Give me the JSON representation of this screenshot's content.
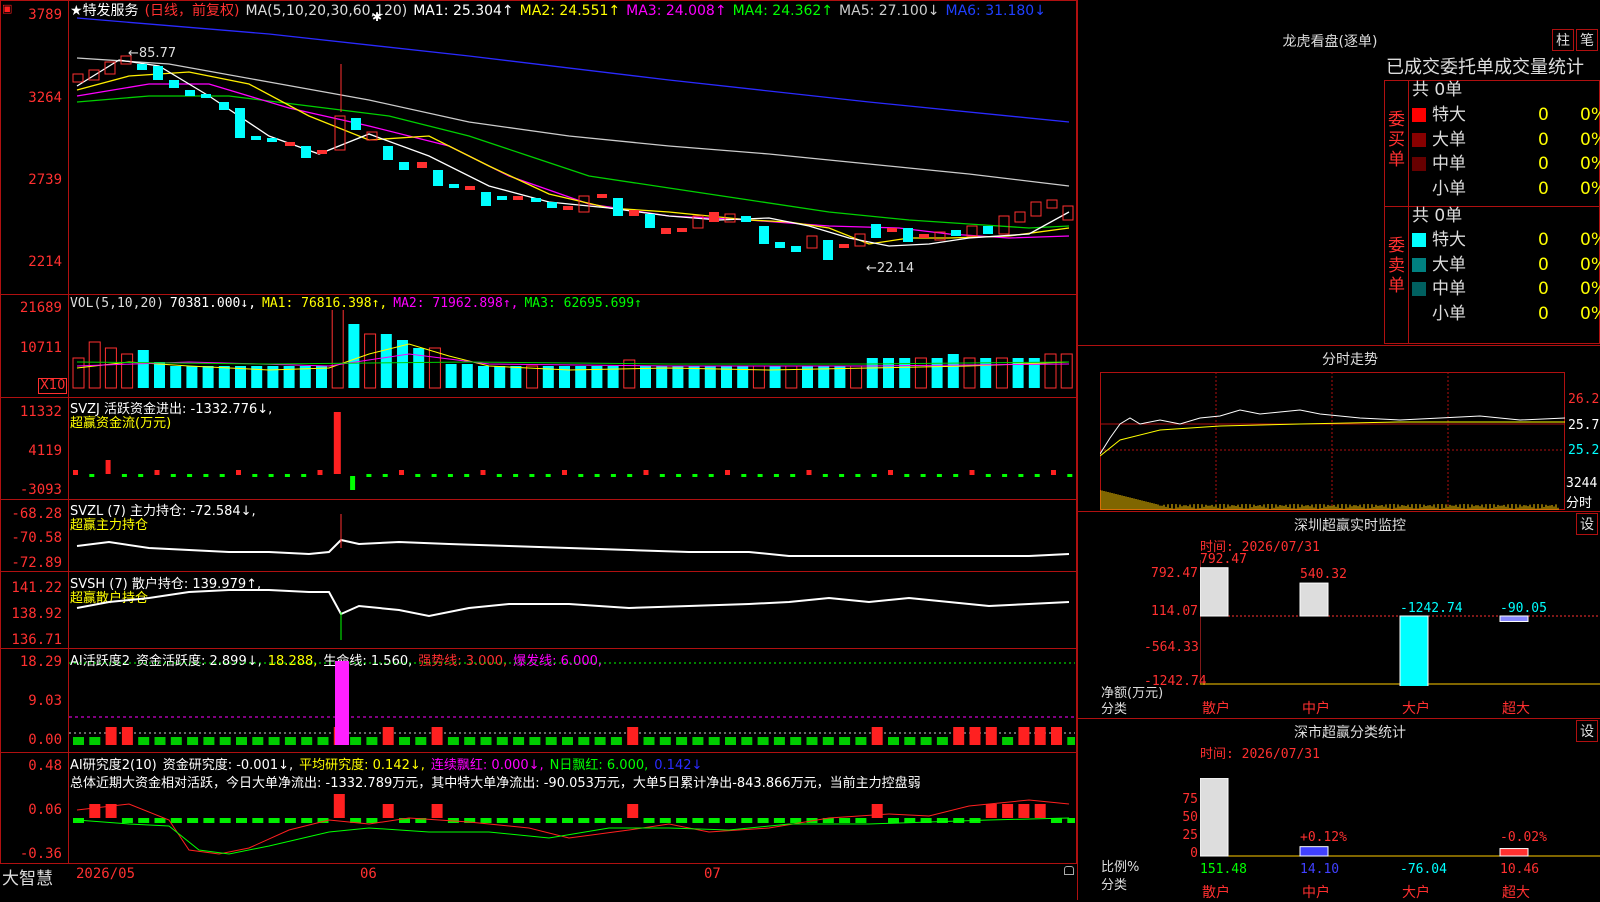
{
  "chart_header": {
    "flag": "▣",
    "star": "★",
    "name": "特发服务",
    "period": "(日线，前复权)",
    "ma_params": "MA(5,10,20,30,60,120)",
    "ma1": "MA1: 25.304↑",
    "ma2": "MA2: 24.551↑",
    "ma3": "MA3: 24.008↑",
    "ma4": "MA4: 24.362↑",
    "ma5": "MA5: 27.100↓",
    "ma6": "MA6: 31.180↓"
  },
  "price_axis": [
    "3789",
    "3264",
    "2739",
    "2214"
  ],
  "price_annotations": {
    "high": "←85.77",
    "low": "←22.14",
    "marker": "✱"
  },
  "vol_header": {
    "label": "VOL(5,10,20)",
    "value": "70381.000↓,",
    "ma1": "MA1: 76816.398↑,",
    "ma2": "MA2: 71962.898↑,",
    "ma3": "MA3: 62695.699↑"
  },
  "vol_axis": [
    "21689",
    "10711"
  ],
  "vol_unit": "X10",
  "svzj": {
    "title": "SVZJ  活跃资金进出: -1332.776↓,",
    "sub": "超赢资金流(万元)",
    "axis": [
      "11332",
      "4119",
      "-3093"
    ]
  },
  "svzl": {
    "title": "SVZL (7) 主力持仓: -72.584↓,",
    "sub": "超赢主力持仓",
    "axis": [
      "-68.28",
      "-70.58",
      "-72.89"
    ]
  },
  "svsh": {
    "title": "SVSH (7) 散户持仓: 139.979↑,",
    "sub": "超赢散户持仓",
    "axis": [
      "141.22",
      "138.92",
      "136.71"
    ]
  },
  "ai_active": {
    "title": "AI活跃度2",
    "t1": "资金活跃度: 2.899↓,",
    "t2": "18.288,",
    "t3": "生命线: 1.560,",
    "t4": "强势线: 3.000,",
    "t5": "爆发线: 6.000,",
    "axis": [
      "18.29",
      "9.03",
      "0.00"
    ]
  },
  "ai_research": {
    "title": "AI研究度2(10)",
    "t1": "资金研究度: -0.001↓,",
    "t2": "平均研究度: 0.142↓,",
    "t3": "连续飘红: 0.000↓,",
    "t4": "N日飘红: 6.000,",
    "t5": "0.142↓",
    "summary": "总体近期大资金相对活跃，今日大单净流出: -1332.789万元，其中特大单净流出: -90.053万元，大单5日累计净出-843.866万元，当前主力控盘弱",
    "axis": [
      "0.48",
      "0.06",
      "-0.36"
    ]
  },
  "date_axis": [
    "2026/05",
    "06",
    "07"
  ],
  "brand": "大智慧",
  "lhb": {
    "title": "龙虎看盘(逐单)",
    "btn1": "柱",
    "btn2": "笔",
    "tabs": "已成交委托单成交量统计",
    "buy_label": "委买单",
    "sell_label": "委卖单",
    "buy_total": "共 0单",
    "sell_total": "共 0单",
    "rows": [
      {
        "name": "特大",
        "count": "0",
        "pct": "0%"
      },
      {
        "name": "大单",
        "count": "0",
        "pct": "0%"
      },
      {
        "name": "中单",
        "count": "0",
        "pct": "0%"
      },
      {
        "name": "小单",
        "count": "0",
        "pct": "0%"
      }
    ],
    "buy_colors": [
      "#ff0000",
      "#880000",
      "#660000",
      "#000000"
    ],
    "sell_colors": [
      "#00ffff",
      "#008080",
      "#006060",
      "#000000"
    ]
  },
  "intraday": {
    "title": "分时走势",
    "axis": [
      "26.22",
      "25.72",
      "25.22"
    ],
    "vol_value": "3244",
    "vol_label": "分时"
  },
  "monitor": {
    "title": "深圳超赢实时监控",
    "btn": "设",
    "time": "时间: 2026/07/31",
    "axis": [
      "792.47",
      "114.07",
      "-564.33",
      "-1242.74"
    ],
    "unit": "净额(万元)",
    "cat_label": "分类",
    "categories": [
      "散户",
      "中户",
      "大户",
      "超大"
    ],
    "values": [
      "792.47",
      "540.32",
      "-1242.74",
      "-90.05"
    ]
  },
  "classify": {
    "title": "深市超赢分类统计",
    "btn": "设",
    "time": "时间: 2026/07/31",
    "axis": [
      "75",
      "50",
      "25",
      "0"
    ],
    "unit": "比例%",
    "cat_label": "分类",
    "categories": [
      "散户",
      "中户",
      "大户",
      "超大"
    ],
    "values": [
      "151.48",
      "14.10",
      "-76.04",
      "10.46"
    ],
    "pcts": [
      "",
      "+0.12%",
      "",
      "-0.02%"
    ]
  }
}
